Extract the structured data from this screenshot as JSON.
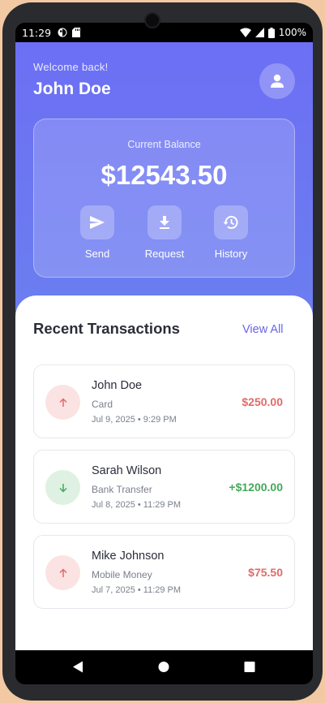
{
  "statusbar": {
    "time": "11:29",
    "battery": "100%",
    "icons": [
      "notification-icon",
      "sd-card-icon",
      "wifi-icon",
      "signal-icon",
      "battery-icon"
    ]
  },
  "header": {
    "welcome": "Welcome back!",
    "user_name": "John Doe",
    "avatar_icon": "person-icon"
  },
  "balance": {
    "label": "Current Balance",
    "amount": "$12543.50",
    "actions": [
      {
        "label": "Send",
        "icon": "send-icon"
      },
      {
        "label": "Request",
        "icon": "download-icon"
      },
      {
        "label": "History",
        "icon": "history-icon"
      }
    ]
  },
  "transactions": {
    "title": "Recent Transactions",
    "view_all": "View All",
    "items": [
      {
        "name": "John Doe",
        "method": "Card",
        "date": "Jul 9, 2025 • 9:29 PM",
        "amount": "$250.00",
        "direction": "outgoing",
        "color": "#e06b6b"
      },
      {
        "name": "Sarah Wilson",
        "method": "Bank Transfer",
        "date": "Jul 8, 2025 • 11:29 PM",
        "amount": "+$1200.00",
        "direction": "incoming",
        "color": "#45a85a"
      },
      {
        "name": "Mike Johnson",
        "method": "Mobile Money",
        "date": "Jul 7, 2025 • 11:29 PM",
        "amount": "$75.50",
        "direction": "outgoing",
        "color": "#e06b6b"
      }
    ]
  },
  "colors": {
    "gradient_top": "#6c6ff4",
    "gradient_bottom": "#5b9ae6",
    "accent": "#6a64e6",
    "outgoing": "#e06b6b",
    "incoming": "#45a85a"
  }
}
